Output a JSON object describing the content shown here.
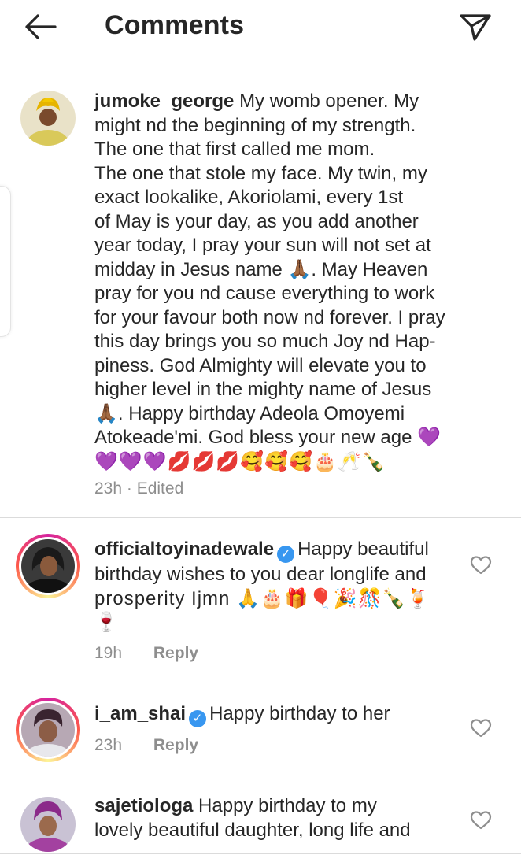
{
  "header": {
    "title": "Comments"
  },
  "caption": {
    "username": "jumoke_george",
    "body_lines": [
      "My womb opener. My",
      "might nd the beginning of my strength.",
      "The one that first called me mom.",
      "The one that stole my face. My twin, my",
      "exact lookalike, Akoriolami, every 1st",
      "of May is your day, as you add another",
      "year today, I pray your sun will not set at",
      "midday in Jesus name 🙏🏾. May Heaven",
      "pray for you nd cause everything to work",
      "for your favour both now nd forever. I pray",
      "this day brings you so much Joy nd Hap-",
      "piness. God Almighty will elevate you to",
      "higher level in the mighty name of Jesus",
      "🙏🏾. Happy birthday Adeola Omoyemi",
      "Atokeade'mi. God bless your new age 💜",
      "💜💜💜💋💋💋🥰🥰🥰🎂🥂🍾"
    ],
    "time": "23h · Edited"
  },
  "comments": [
    {
      "username": "officialtoyinadewale",
      "verified": true,
      "line1": "Happy beautiful",
      "line2": "birthday wishes to you dear longlife and",
      "line3": "prosperity Ijmn 🙏🎂🎁🎈🎉🎊🍾🍹",
      "line4": "🍷",
      "time": "19h",
      "reply": "Reply",
      "like_icon": "heart-outline-icon"
    },
    {
      "username": "i_am_shai",
      "verified": true,
      "line1": "Happy birthday to her",
      "time": "23h",
      "reply": "Reply",
      "like_icon": "heart-outline-icon"
    },
    {
      "username": "sajetiologa",
      "verified": false,
      "line1": "Happy birthday to my",
      "line2": "lovely beautiful daughter, long life and",
      "like_icon": "heart-outline-icon"
    }
  ],
  "colors": {
    "text": "#262626",
    "meta": "#8e8e8e",
    "verified": "#3897f0",
    "divider": "#dbdbdb"
  }
}
